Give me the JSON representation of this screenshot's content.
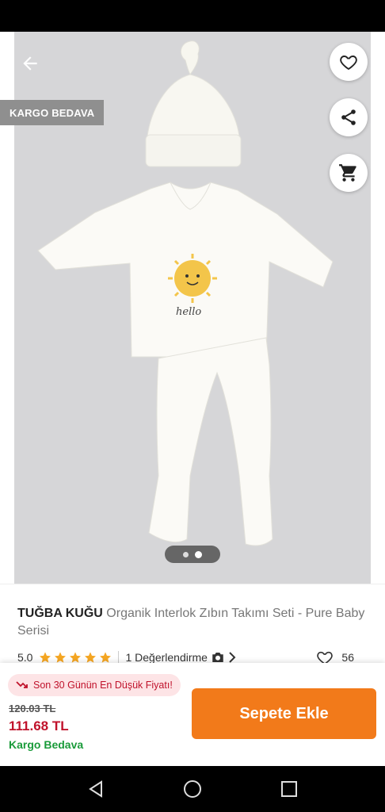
{
  "gallery": {
    "badge": "KARGO BEDAVA",
    "illustration_text": "hello",
    "icons": {
      "back": "arrow-left-icon",
      "favorite": "heart-icon",
      "share": "share-icon",
      "cart": "cart-icon"
    },
    "page_indicator": {
      "total": 2,
      "active": 2
    }
  },
  "product": {
    "brand": "TUĞBA KUĞU",
    "name": "Organik Interlok Zıbın Takımı Seti - Pure Baby Serisi",
    "rating": "5.0",
    "stars": 5,
    "reviews_label": "1 Değerlendirme",
    "likes": "56"
  },
  "purchase": {
    "lowest_price_badge": "Son 30 Günün En Düşük Fiyatı!",
    "old_price": "120.03 TL",
    "price": "111.68 TL",
    "shipping": "Kargo Bedava",
    "add_to_cart_label": "Sepete Ekle"
  },
  "colors": {
    "accent": "#f27a1a",
    "price": "#c0122b",
    "shipping": "#1a9b3a",
    "star": "#f5a623"
  }
}
